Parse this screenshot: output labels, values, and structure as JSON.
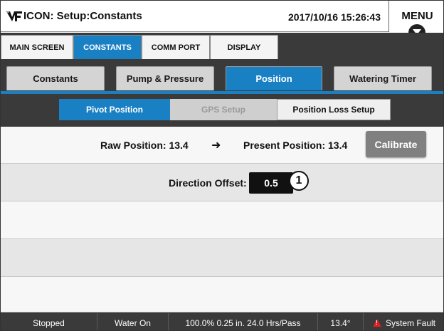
{
  "header": {
    "title": "ICON: Setup:Constants",
    "datetime": "2017/10/16 15:26:43",
    "menu_label": "MENU",
    "logo_icon": "icon-logo"
  },
  "topnav": {
    "tabs": [
      {
        "label": "MAIN SCREEN",
        "active": false
      },
      {
        "label": "CONSTANTS",
        "active": true
      },
      {
        "label": "COMM PORT",
        "active": false
      },
      {
        "label": "DISPLAY",
        "active": false
      }
    ]
  },
  "subnav": {
    "tabs": [
      {
        "label": "Constants",
        "active": false
      },
      {
        "label": "Pump & Pressure",
        "active": false
      },
      {
        "label": "Position",
        "active": true
      },
      {
        "label": "Watering Timer",
        "active": false
      }
    ]
  },
  "section": {
    "buttons": [
      {
        "label": "Pivot Position",
        "state": "active"
      },
      {
        "label": "GPS Setup",
        "state": "disabled"
      },
      {
        "label": "Position Loss Setup",
        "state": "normal"
      }
    ]
  },
  "position": {
    "raw": "Raw Position: 13.4",
    "arrow": "➜",
    "present": "Present Position: 13.4",
    "calibrate_label": "Calibrate",
    "direction_label": "Direction Offset:",
    "direction_value": "0.5",
    "callout": "1"
  },
  "status": {
    "state": "Stopped",
    "water": "Water On",
    "rate": "100.0%  0.25 in.  24.0 Hrs/Pass",
    "angle": "13.4°",
    "fault": "System Fault"
  },
  "colors": {
    "accent": "#1a80c4",
    "dark": "#3a3a3a",
    "fault": "#e02020"
  }
}
